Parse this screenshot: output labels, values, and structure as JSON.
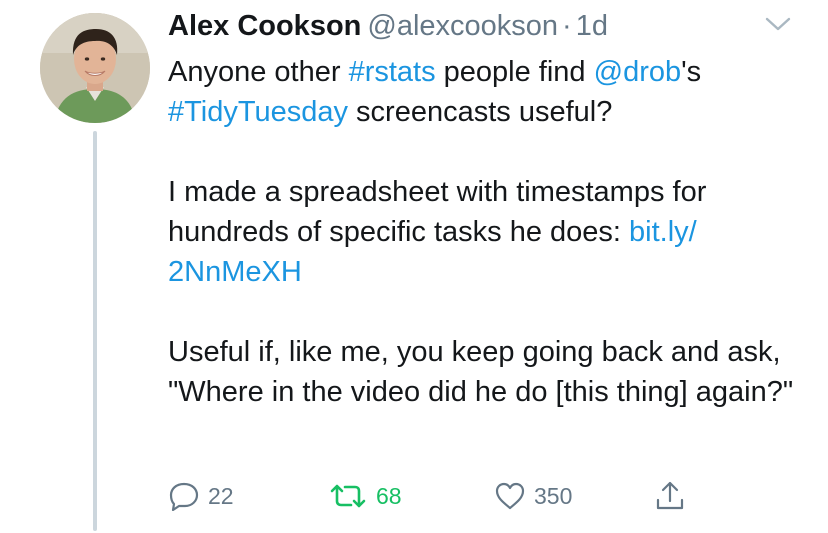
{
  "tweet": {
    "display_name": "Alex Cookson",
    "handle": "@alexcookson",
    "separator": "·",
    "time": "1d",
    "body": {
      "p1": {
        "t1": "Anyone other ",
        "hashtag_rstats": "#rstats",
        "t2": " people find ",
        "mention_drob": "@drob",
        "t3": "'s",
        "hashtag_tidytuesday": "#TidyTuesday",
        "t4": " screencasts useful?"
      },
      "p2": {
        "t1": "I made a spreadsheet with timestamps for hundreds of specific tasks he does: ",
        "link": "bit.ly/​2NnMeXH"
      },
      "p3": "Useful if, like me, you keep going back and ask, \"Where in the video did he do [this thing] again?\""
    },
    "actions": {
      "reply_count": "22",
      "retweet_count": "68",
      "like_count": "350"
    }
  },
  "colors": {
    "link": "#1b95e0",
    "muted": "#657786",
    "retweet_active": "#17bf63",
    "thread_line": "#ccd6dd"
  },
  "icons": [
    "reply-icon",
    "retweet-icon",
    "like-icon",
    "share-icon",
    "chevron-down-icon"
  ]
}
